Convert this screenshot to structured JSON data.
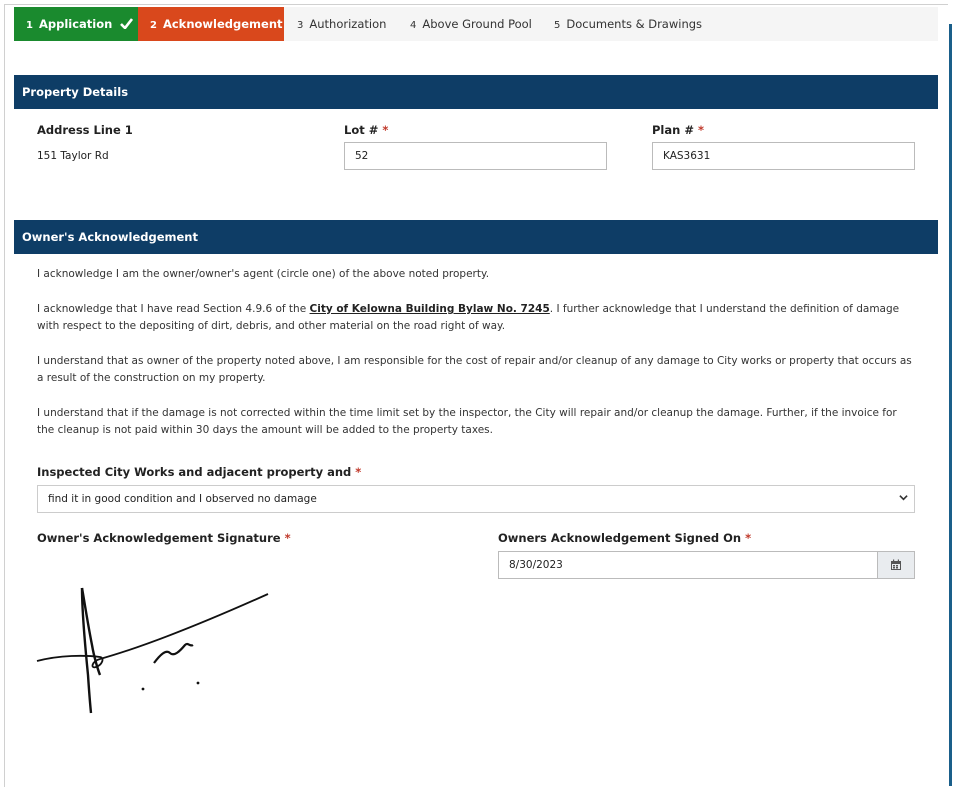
{
  "tabs": [
    {
      "num": "1",
      "label": "Application",
      "state": "complete"
    },
    {
      "num": "2",
      "label": "Acknowledgement",
      "state": "active"
    },
    {
      "num": "3",
      "label": "Authorization",
      "state": "pending"
    },
    {
      "num": "4",
      "label": "Above Ground Pool",
      "state": "pending"
    },
    {
      "num": "5",
      "label": "Documents & Drawings",
      "state": "pending"
    }
  ],
  "property": {
    "header": "Property Details",
    "address_label": "Address Line 1",
    "address_value": "151 Taylor Rd",
    "lot_label": "Lot #",
    "lot_value": "52",
    "plan_label": "Plan #",
    "plan_value": "KAS3631",
    "required_mark": "*"
  },
  "ack": {
    "header": "Owner's Acknowledgement",
    "p1": "I acknowledge I am the owner/owner's agent (circle one) of the above noted property.",
    "p2_before": "I acknowledge that I have read Section 4.9.6 of the ",
    "p2_link": "City of Kelowna Building Bylaw No. 7245",
    "p2_after": ". I further acknowledge that I understand the definition of damage with respect to the depositing of dirt, debris, and other material on the road right of way.",
    "p3": "I understand that as owner of the property noted above, I am responsible for the cost of repair and/or cleanup of any damage to City works or property that occurs as a result of the construction on my property.",
    "p4": "I understand that if the damage is not corrected within the time limit set by the inspector, the City will repair and/or cleanup the damage. Further, if the invoice for the cleanup is not paid within 30 days the amount will be added to the property taxes.",
    "inspected_label": "Inspected City Works and adjacent property and",
    "inspected_value": "find it in good condition and I observed no damage",
    "signature_label": "Owner's Acknowledgement Signature",
    "signed_on_label": "Owners Acknowledgement Signed On",
    "signed_on_value": "8/30/2023"
  },
  "colors": {
    "complete": "#1a8a2e",
    "active": "#d9481c",
    "header": "#0e3d66",
    "required": "#c0392b"
  },
  "icons": {
    "tab_complete": "checkmark-icon",
    "select": "chevron-down-icon",
    "date": "calendar-icon"
  }
}
